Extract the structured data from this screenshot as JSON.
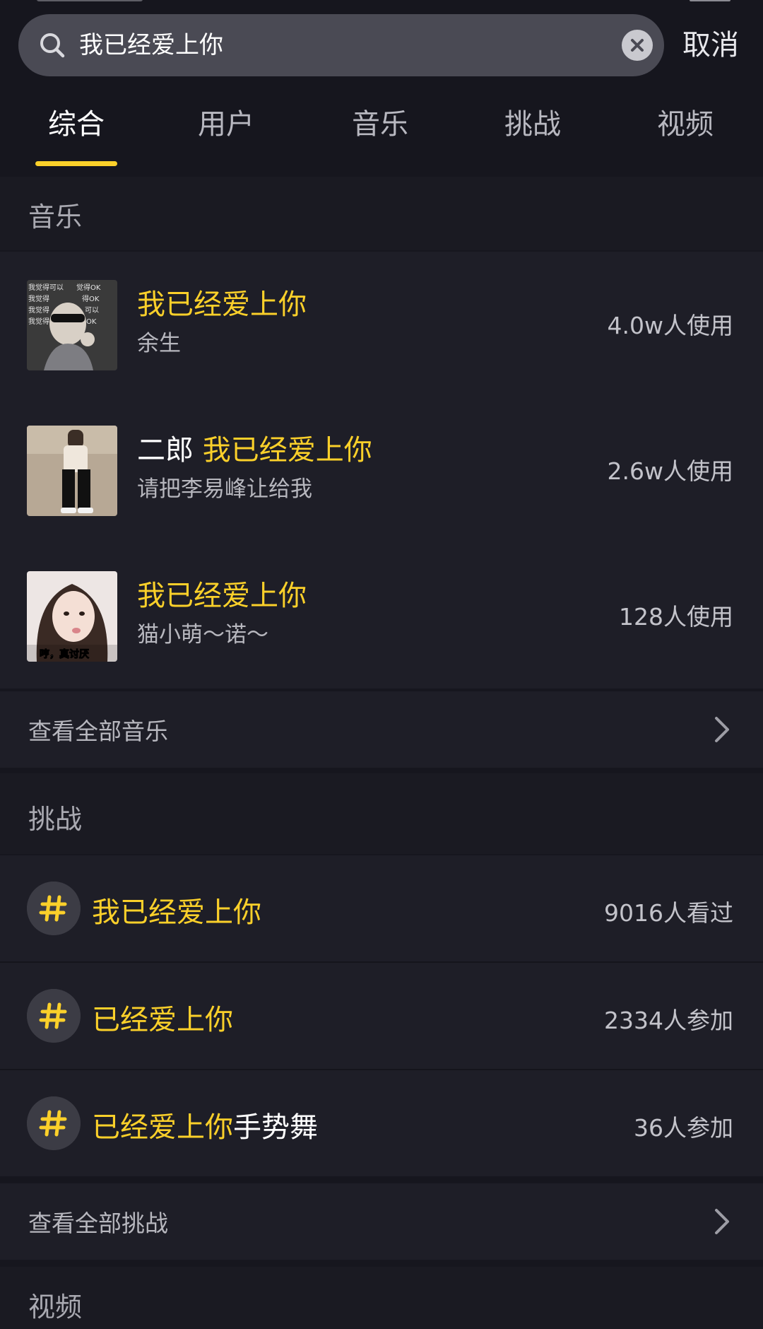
{
  "search": {
    "query": "我已经爱上你",
    "cancel_label": "取消"
  },
  "tabs": [
    {
      "label": "综合",
      "active": true
    },
    {
      "label": "用户",
      "active": false
    },
    {
      "label": "音乐",
      "active": false
    },
    {
      "label": "挑战",
      "active": false
    },
    {
      "label": "视频",
      "active": false
    }
  ],
  "music": {
    "section_title": "音乐",
    "items": [
      {
        "title_prefix": "",
        "title_highlight": "我已经爱上你",
        "artist": "余生",
        "usage": "4.0w人使用"
      },
      {
        "title_prefix": "二郎 ",
        "title_highlight": "我已经爱上你",
        "artist": "请把李易峰让给我",
        "usage": "2.6w人使用"
      },
      {
        "title_prefix": "",
        "title_highlight": "我已经爱上你",
        "artist": "猫小萌～诺～",
        "usage": "128人使用"
      }
    ],
    "thumb_texts": {
      "first": "我觉得可以 觉得OK",
      "third": "哼，真讨厌"
    },
    "view_all_label": "查看全部音乐"
  },
  "challenges": {
    "section_title": "挑战",
    "items": [
      {
        "highlight": "我已经爱上你",
        "suffix": "",
        "count": "9016人看过"
      },
      {
        "highlight": "已经爱上你",
        "suffix": "",
        "count": "2334人参加"
      },
      {
        "highlight": "已经爱上你",
        "suffix": "手势舞",
        "count": "36人参加"
      }
    ],
    "view_all_label": "查看全部挑战"
  },
  "videos": {
    "section_title": "视频"
  },
  "colors": {
    "accent": "#fbd02a",
    "background": "#16161e",
    "card": "#1e1e27"
  }
}
